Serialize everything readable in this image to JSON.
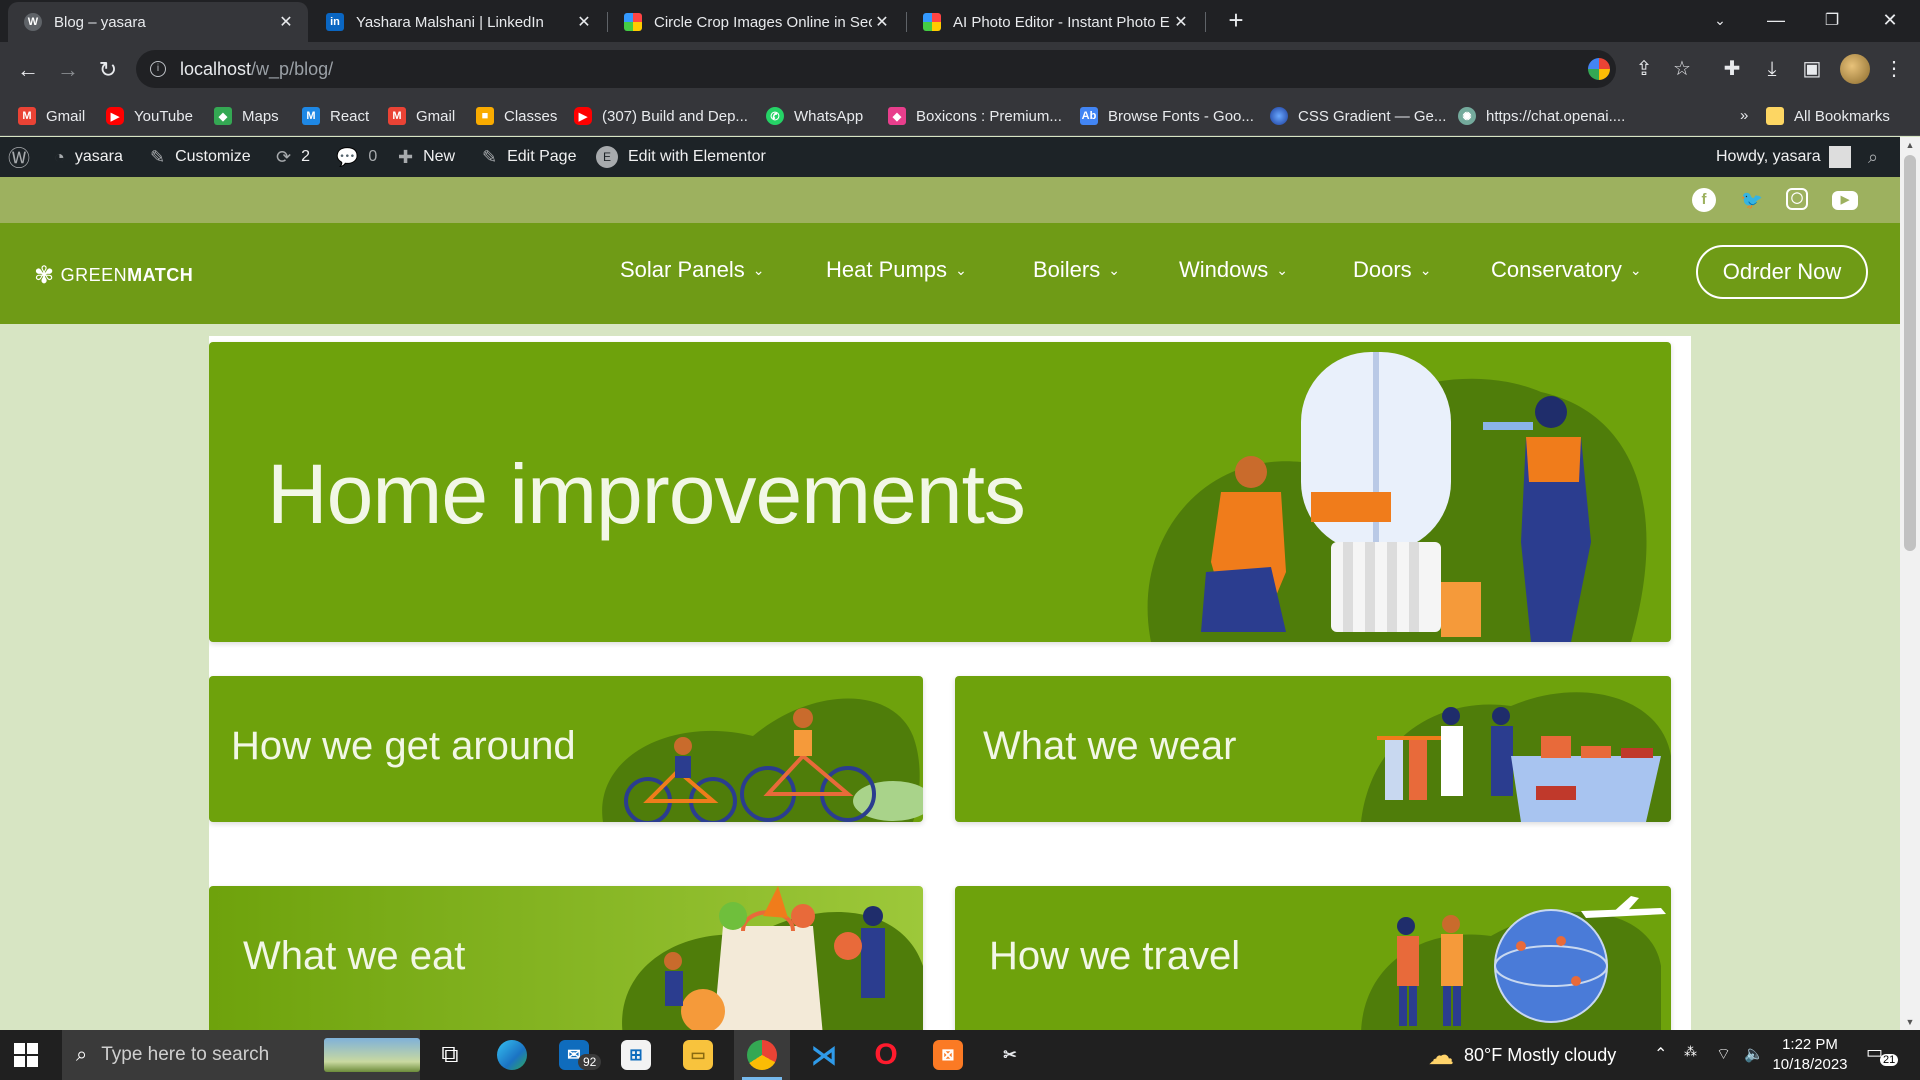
{
  "browser": {
    "tabs": [
      {
        "title": "Blog – yasara",
        "icon": "wordpress-icon"
      },
      {
        "title": "Yashara Malshani | LinkedIn",
        "icon": "linkedin-icon"
      },
      {
        "title": "Circle Crop Images Online in Sec",
        "icon": "circle-crop-icon"
      },
      {
        "title": "AI Photo Editor - Instant Photo E",
        "icon": "photo-editor-icon"
      }
    ],
    "url_host": "localhost",
    "url_path": "/w_p/blog/",
    "bookmarks": [
      {
        "label": "Gmail",
        "icon": "gmail-icon"
      },
      {
        "label": "YouTube",
        "icon": "youtube-icon"
      },
      {
        "label": "Maps",
        "icon": "maps-icon"
      },
      {
        "label": "React",
        "icon": "react-icon"
      },
      {
        "label": "Gmail",
        "icon": "gmail-icon"
      },
      {
        "label": "Classes",
        "icon": "classes-icon"
      },
      {
        "label": "(307) Build and Dep...",
        "icon": "youtube-icon"
      },
      {
        "label": "WhatsApp",
        "icon": "whatsapp-icon"
      },
      {
        "label": "Boxicons : Premium...",
        "icon": "boxicons-icon"
      },
      {
        "label": "Browse Fonts - Goo...",
        "icon": "google-fonts-icon"
      },
      {
        "label": "CSS Gradient — Ge...",
        "icon": "css-gradient-icon"
      },
      {
        "label": "https://chat.openai....",
        "icon": "openai-icon"
      }
    ],
    "more_bookmarks": "»",
    "all_bookmarks": "All Bookmarks"
  },
  "adminbar": {
    "site": "yasara",
    "customize": "Customize",
    "updates": "2",
    "comments": "0",
    "new": "New",
    "edit_page": "Edit Page",
    "elementor": "Edit with Elementor",
    "howdy": "Howdy, yasara"
  },
  "site": {
    "logo_light": "GREEN",
    "logo_bold": "MATCH",
    "social": [
      "facebook-icon",
      "twitter-icon",
      "instagram-icon",
      "youtube-icon"
    ],
    "menu": [
      {
        "label": "Solar Panels"
      },
      {
        "label": "Heat Pumps"
      },
      {
        "label": "Boilers"
      },
      {
        "label": "Windows"
      },
      {
        "label": "Doors"
      },
      {
        "label": "Conservatory"
      }
    ],
    "order_button": "Odrder Now",
    "cards": {
      "hero": "Home improvements",
      "get_around": "How we get around",
      "wear": "What we wear",
      "eat": "What we eat",
      "travel": "How we travel"
    },
    "colors": {
      "brand": "#6f9b16",
      "card": "#6ea20c",
      "strip": "#9db15f",
      "page_bg": "#d7e5c3"
    }
  },
  "taskbar": {
    "search_placeholder": "Type here to search",
    "mail_badge": "92",
    "weather": "80°F  Mostly cloudy",
    "time": "1:22 PM",
    "date": "10/18/2023",
    "notifications": "21"
  }
}
